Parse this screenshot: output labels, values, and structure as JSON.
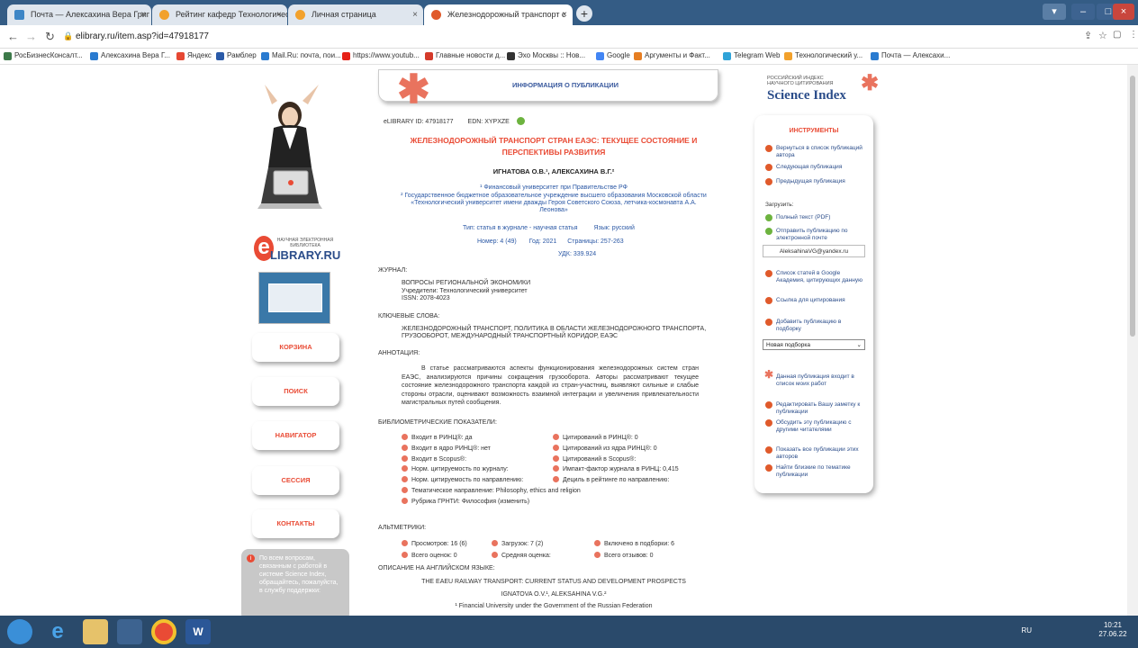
{
  "tabs": [
    {
      "title": "Почта — Алексахина Вера Григ",
      "close": "×"
    },
    {
      "title": "Рейтинг кафедр Технологическо",
      "close": "×"
    },
    {
      "title": "Личная страница",
      "close": "×"
    },
    {
      "title": "Железнодорожный транспорт с",
      "close": "×"
    }
  ],
  "new_tab": "+",
  "url": "elibrary.ru/item.asp?id=47918177",
  "bookmarks": [
    "РосБизнесКонсалт...",
    "Алексахина Вера Г...",
    "Яндекс",
    "Рамблер",
    "Mail.Ru: почта, пои...",
    "https://www.youtub...",
    "Главные новости д...",
    "Эхо Москвы :: Нов...",
    "Google",
    "Аргументы и Факт...",
    "Telegram Web",
    "Технологический у...",
    "Почта — Алексахи..."
  ],
  "banner": "ИНФОРМАЦИЯ О ПУБЛИКАЦИИ",
  "ids": {
    "elibrary": "eLIBRARY ID: 47918177",
    "edn": "EDN: XYPXZE"
  },
  "title": "ЖЕЛЕЗНОДОРОЖНЫЙ ТРАНСПОРТ СТРАН ЕАЭС: ТЕКУЩЕЕ СОСТОЯНИЕ И ПЕРСПЕКТИВЫ РАЗВИТИЯ",
  "authors": "ИГНАТОВА О.В.¹, АЛЕКСАХИНА В.Г.²",
  "aff1": "¹ Финансовый университет при Правительстве РФ",
  "aff2": "² Государственное бюджетное образовательное учреждение высшего образования Московской области «Технологический университет имени дважды Героя Советского Союза, летчика-космонавта А.А. Леонова»",
  "meta": {
    "type": "Тип: статья в журнале - научная статья",
    "lang": "Язык: русский",
    "number": "Номер: 4 (49)",
    "year": "Год: 2021",
    "pages": "Страницы: 257-263",
    "udk": "УДК: 339.924"
  },
  "journal": {
    "label": "ЖУРНАЛ:",
    "name": "ВОПРОСЫ РЕГИОНАЛЬНОЙ ЭКОНОМИКИ",
    "founder": "Учредители: Технологический университет",
    "issn": "ISSN: 2078-4023"
  },
  "keywords": {
    "label": "КЛЮЧЕВЫЕ СЛОВА:",
    "text": "ЖЕЛЕЗНОДОРОЖНЫЙ ТРАНСПОРТ, ПОЛИТИКА В ОБЛАСТИ ЖЕЛЕЗНОДОРОЖНОГО ТРАНСПОРТА, ГРУЗООБОРОТ, МЕЖДУНАРОДНЫЙ ТРАНСПОРТНЫЙ КОРИДОР, ЕАЭС"
  },
  "annotation": {
    "label": "АННОТАЦИЯ:",
    "text": "В статье рассматриваются аспекты функционирования железнодорожных систем стран ЕАЭС, анализируются причины сокращения грузооборота. Авторы рассматривают текущее состояние железнодорожного транспорта каждой из стран-участниц, выявляют сильные и слабые стороны отрасли, оценивают возможность взаимной интеграции и увеличения привлекательности магистральных путей сообщения."
  },
  "biblio": {
    "label": "БИБЛИОМЕТРИЧЕСКИЕ ПОКАЗАТЕЛИ:",
    "left": [
      "Входит в РИНЦ®: да",
      "Входит в ядро РИНЦ®: нет",
      "Входит в Scopus®:",
      "Норм. цитируемость по журналу:",
      "Норм. цитируемость по направлению:",
      "Тематическое направление: Philosophy, ethics and religion",
      "Рубрика ГРНТИ: Философия (изменить)"
    ],
    "right": [
      "Цитирований в РИНЦ®: 0",
      "Цитирований из ядра РИНЦ®: 0",
      "Цитирований в Scopus®:",
      "Импакт-фактор журнала в РИНЦ: 0,415",
      "Дециль в рейтинге по направлению:"
    ]
  },
  "altmetrics": {
    "label": "АЛЬТМЕТРИКИ:",
    "items": [
      "Просмотров: 16 (6)",
      "Загрузок: 7 (2)",
      "Включено в подборки: 6",
      "Всего оценок: 0",
      "Средняя оценка:",
      "Всего отзывов: 0"
    ]
  },
  "english": {
    "label": "ОПИСАНИЕ НА АНГЛИЙСКОМ ЯЗЫКЕ:",
    "title": "THE EAEU RAILWAY TRANSPORT: CURRENT STATUS AND DEVELOPMENT PROSPECTS",
    "authors": "IGNATOVA O.V.¹, ALEKSAHINA V.G.²",
    "aff1": "¹ Financial University under the Government of the Russian Federation"
  },
  "left_menu": [
    "КОРЗИНА",
    "ПОИСК",
    "НАВИГАТОР",
    "СЕССИЯ",
    "КОНТАКТЫ"
  ],
  "logo": {
    "small": "НАУЧНАЯ ЭЛЕКТРОННАЯ БИБЛИОТЕКА",
    "big": "LIBRARY.RU"
  },
  "help": "По всем вопросам, связанным с работой в системе Science Index, обращайтесь, пожалуйста, в службу поддержки:",
  "science_index": {
    "small": "РОССИЙСКИЙ ИНДЕКС НАУЧНОГО ЦИТИРОВАНИЯ",
    "big": "Science Index"
  },
  "tools": {
    "title": "ИНСТРУМЕНТЫ",
    "nav": [
      "Вернуться в список публикаций автора",
      "Следующая публикация",
      "Предыдущая публикация"
    ],
    "download_label": "Загрузить:",
    "full_text": "Полный текст (PDF)",
    "send_email": "Отправить публикацию по электронной почте",
    "email": "AleksahinaVG@yandex.ru",
    "scholar": "Список статей в Google Академия, цитирующих данную",
    "cite": "Ссылка для цитирования",
    "add_coll": "Добавить публикацию в подборку",
    "coll_value": "Новая подборка",
    "in_list": "Данная публикация входит в список моих работ",
    "edit_note": "Редактировать Вашу заметку к публикации",
    "discuss": "Обсудить эту публикацию с другими читателями",
    "show_all": "Показать все публикации этих авторов",
    "similar": "Найти близкие по тематике публикации"
  },
  "tray": {
    "lang": "RU",
    "time": "10:21",
    "date": "27.06.22"
  }
}
